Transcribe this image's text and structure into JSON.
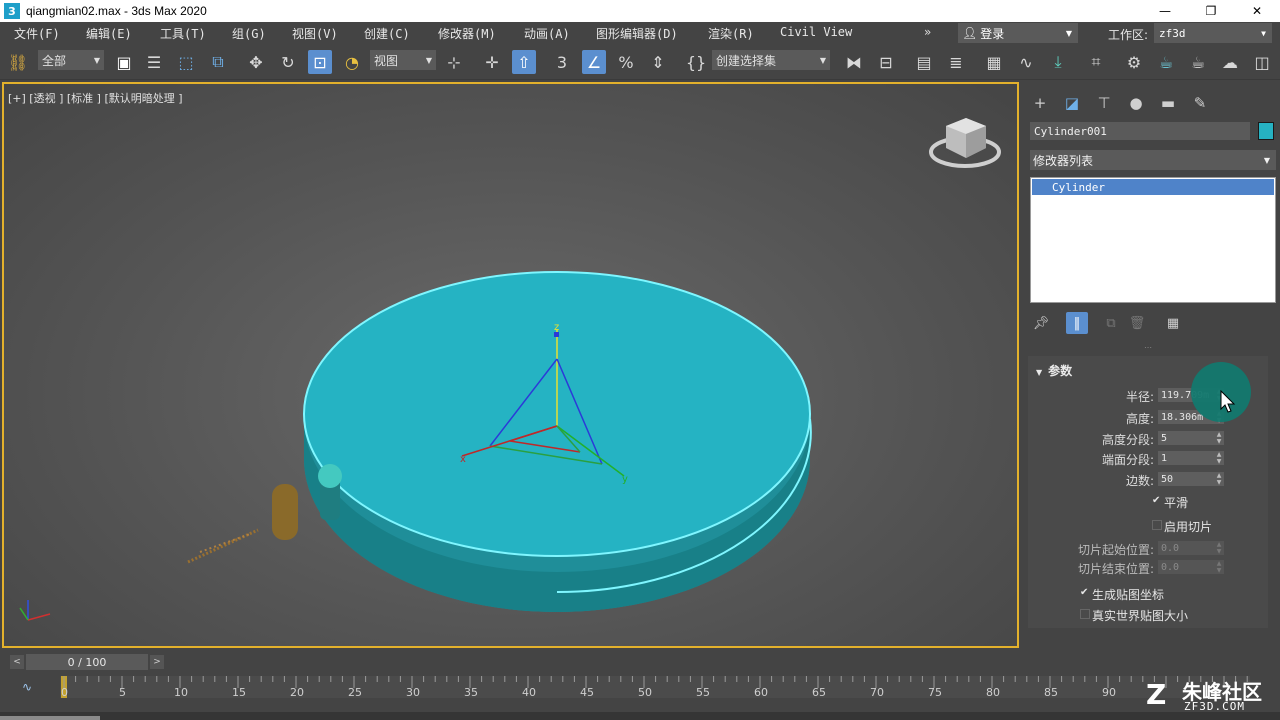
{
  "window": {
    "title": "qiangmian02.max - 3ds Max 2020",
    "app_icon": "3",
    "min": "—",
    "max": "❐",
    "close": "✕"
  },
  "menu": {
    "items": [
      "文件(F)",
      "编辑(E)",
      "工具(T)",
      "组(G)",
      "视图(V)",
      "创建(C)",
      "修改器(M)",
      "动画(A)",
      "图形编辑器(D)",
      "渲染(R)",
      "Civil View"
    ],
    "more": "»",
    "login": "登录",
    "workspace_label": "工作区:",
    "workspace_value": "zf3d"
  },
  "toolbar": {
    "selection_filter": "全部",
    "ref_coord": "视图",
    "named_selection": "创建选择集",
    "snap_value": "3"
  },
  "viewport": {
    "label": "[+] [透视 ] [标准 ] [默认明暗处理 ]",
    "axis_z": "z",
    "axis_x": "x",
    "axis_y": "y"
  },
  "command_panel": {
    "object_name": "Cylinder001",
    "object_color": "#26b2c2",
    "modifier_list": "修改器列表",
    "stack_items": [
      "Cylinder"
    ],
    "rollout_title": "参数",
    "params": [
      {
        "label": "半径:",
        "value": "119.709m"
      },
      {
        "label": "高度:",
        "value": "18.306m"
      },
      {
        "label": "高度分段:",
        "value": "5"
      },
      {
        "label": "端面分段:",
        "value": "1"
      },
      {
        "label": "边数:",
        "value": "50"
      }
    ],
    "smooth_label": "平滑",
    "smooth_checked": "✔",
    "slice_label": "启用切片",
    "slice_from_label": "切片起始位置:",
    "slice_from_value": "0.0",
    "slice_to_label": "切片结束位置:",
    "slice_to_value": "0.0",
    "gen_map_label": "生成贴图坐标",
    "gen_map_checked": "✔",
    "real_world_label": "真实世界贴图大小"
  },
  "timeline": {
    "frame_display": "0 / 100",
    "prev": "<",
    "next": ">",
    "ticks": [
      "0",
      "5",
      "10",
      "15",
      "20",
      "25",
      "30",
      "35",
      "40",
      "45",
      "50",
      "55",
      "60",
      "65",
      "70",
      "75",
      "80",
      "85",
      "90"
    ]
  },
  "watermark": {
    "logo": "Z",
    "text": "朱峰社区",
    "sub": "ZF3D.COM"
  },
  "colors": {
    "accent": "#5b8fcf",
    "viewport_border": "#e3b12c",
    "cylinder": "#26b2c2"
  }
}
